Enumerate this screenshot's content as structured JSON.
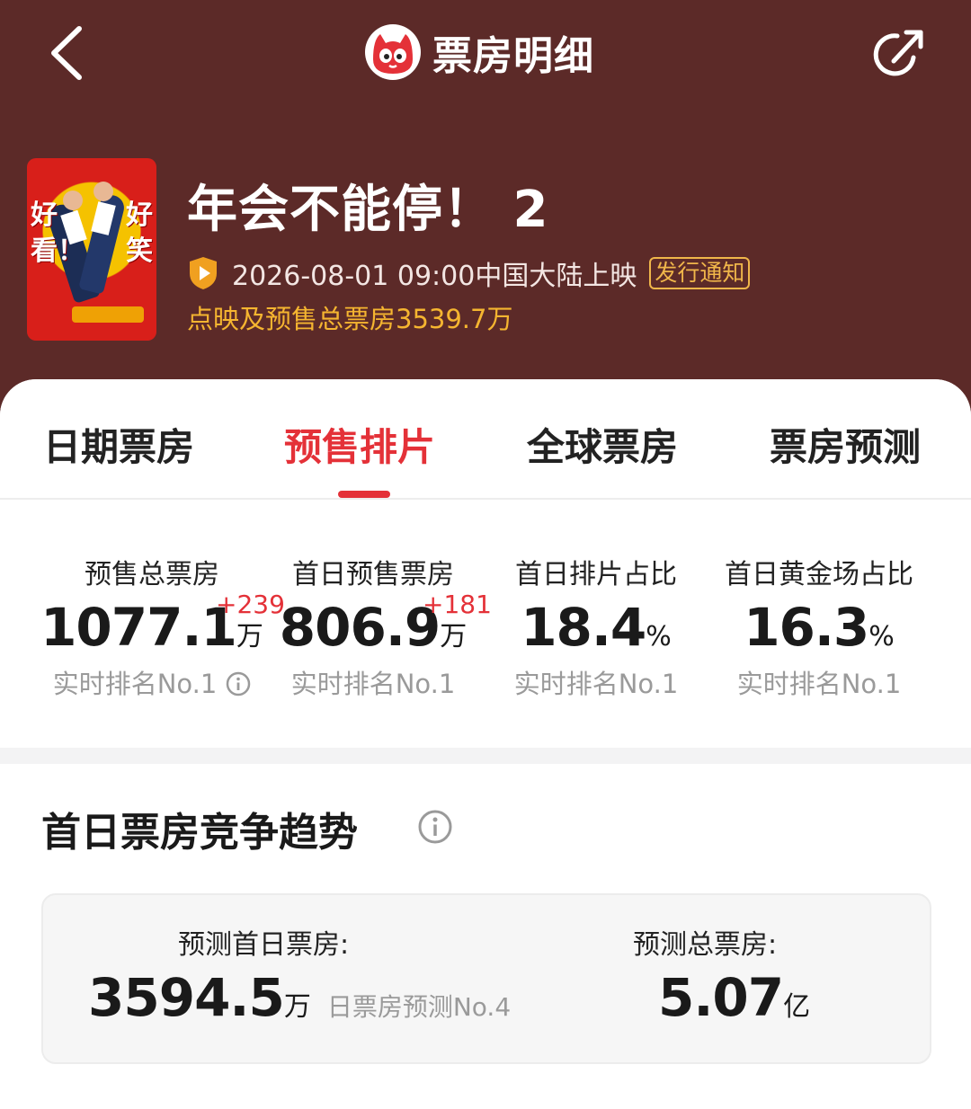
{
  "header": {
    "title": "票房明细",
    "back_icon": "chevron-left-icon",
    "share_icon": "share-icon",
    "logo_icon": "cat-logo-icon"
  },
  "movie": {
    "title": "年会不能停！ 2",
    "release": "2026-08-01 09:00中国大陆上映",
    "release_badge": "发行通知",
    "presale_total": "点映及预售总票房3539.7万",
    "poster_left_text": "好看！",
    "poster_right_text": "好笑！"
  },
  "tabs": [
    {
      "label": "日期票房",
      "active": false
    },
    {
      "label": "预售排片",
      "active": true
    },
    {
      "label": "全球票房",
      "active": false
    },
    {
      "label": "票房预测",
      "active": false
    }
  ],
  "stats": [
    {
      "label": "预售总票房",
      "value": "1077.1",
      "unit": "万",
      "delta": "+239",
      "rank": "实时排名No.1"
    },
    {
      "label": "首日预售票房",
      "value": "806.9",
      "unit": "万",
      "delta": "+181",
      "rank": "实时排名No.1"
    },
    {
      "label": "首日排片占比",
      "value": "18.4",
      "unit": "%",
      "delta": "",
      "rank": "实时排名No.1"
    },
    {
      "label": "首日黄金场占比",
      "value": "16.3",
      "unit": "%",
      "delta": "",
      "rank": "实时排名No.1"
    }
  ],
  "trend": {
    "title": "首日票房竞争趋势",
    "forecast_first_day_label": "预测首日票房:",
    "forecast_first_day_value": "3594.5",
    "forecast_first_day_unit": "万",
    "forecast_first_day_rank": "日票房预测No.4",
    "forecast_total_label": "预测总票房:",
    "forecast_total_value": "5.07",
    "forecast_total_unit": "亿"
  },
  "colors": {
    "header_bg": "#5c2a28",
    "accent_red": "#e43138",
    "gold": "#f5b530"
  }
}
